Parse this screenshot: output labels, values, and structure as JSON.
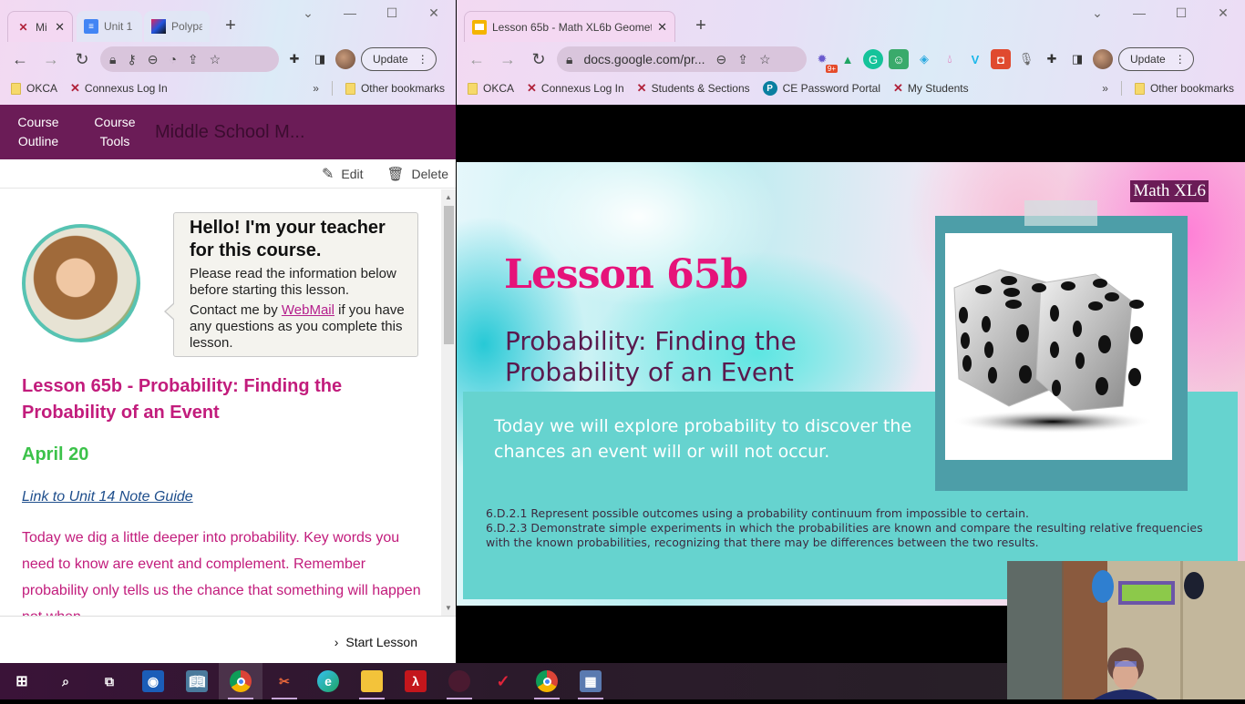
{
  "left_window": {
    "tabs": [
      {
        "title": "Mi",
        "favicon": "connexus-icon",
        "active": true
      },
      {
        "title": "Unit 1",
        "favicon": "google-docs-icon",
        "active": false
      },
      {
        "title": "Polypa",
        "favicon": "polypad-icon",
        "active": false
      }
    ],
    "new_tab_label": "+",
    "bookmarks": [
      {
        "label": "OKCA",
        "icon": "folder-icon"
      },
      {
        "label": "Connexus Log In",
        "icon": "connexus-icon"
      }
    ],
    "other_bookmarks": "Other bookmarks",
    "update_label": "Update",
    "connexus": {
      "nav": [
        {
          "label_line1": "Course",
          "label_line2": "Outline"
        },
        {
          "label_line1": "Course",
          "label_line2": "Tools"
        }
      ],
      "course_title": "Middle School M...",
      "edit_label": "Edit",
      "delete_label": "Delete",
      "bubble": {
        "heading": "Hello! I'm your teacher for this course.",
        "line1": "Please read the information below before starting this lesson.",
        "contact_prefix": "Contact me by ",
        "contact_link": "WebMail",
        "contact_suffix": " if you have any questions as you complete this lesson."
      },
      "lesson_title": "Lesson 65b - Probability: Finding the Probability of an Event",
      "lesson_date": "April 20",
      "note_guide_link": "Link to Unit 14 Note Guide",
      "lesson_description": "Today we dig a little deeper into probability. Key words you need to know are event and complement. Remember probability only tells us the chance that something will happen not when.",
      "start_lesson_label": "Start Lesson"
    }
  },
  "right_window": {
    "tabs": [
      {
        "title": "Lesson 65b - Math XL6b Geomet",
        "favicon": "google-slides-icon",
        "active": true
      }
    ],
    "new_tab_label": "+",
    "address": "docs.google.com/pr...",
    "notification_badge": "9+",
    "bookmarks": [
      {
        "label": "OKCA",
        "icon": "folder-icon"
      },
      {
        "label": "Connexus Log In",
        "icon": "connexus-icon"
      },
      {
        "label": "Students & Sections",
        "icon": "connexus-icon"
      },
      {
        "label": "CE Password Portal",
        "icon": "pearson-icon"
      },
      {
        "label": "My Students",
        "icon": "connexus-icon"
      }
    ],
    "other_bookmarks": "Other bookmarks",
    "update_label": "Update",
    "slide": {
      "badge": "Math XL6",
      "title": "Lesson 65b",
      "subtitle_line1": "Probability: Finding the",
      "subtitle_line2": "Probability of an Event",
      "objective": "Today we will explore probability to discover the chances an event will or will not occur.",
      "standards": [
        "6.D.2.1 Represent possible outcomes using a probability continuum from impossible to certain.",
        "6.D.2.3 Demonstrate simple experiments in which the probabilities are known and compare the resulting relative frequencies with the known probabilities, recognizing that there may be differences between the two results."
      ],
      "image": "dice-image"
    }
  },
  "taskbar": {
    "items": [
      "start-icon",
      "search-icon",
      "task-view-icon",
      "app-icon",
      "kindle-icon",
      "chrome-icon",
      "snipping-tool-icon",
      "edge-icon",
      "file-explorer-icon",
      "acrobat-icon",
      "app-icon",
      "vivi-icon",
      "chrome-icon",
      "calculator-icon"
    ]
  }
}
